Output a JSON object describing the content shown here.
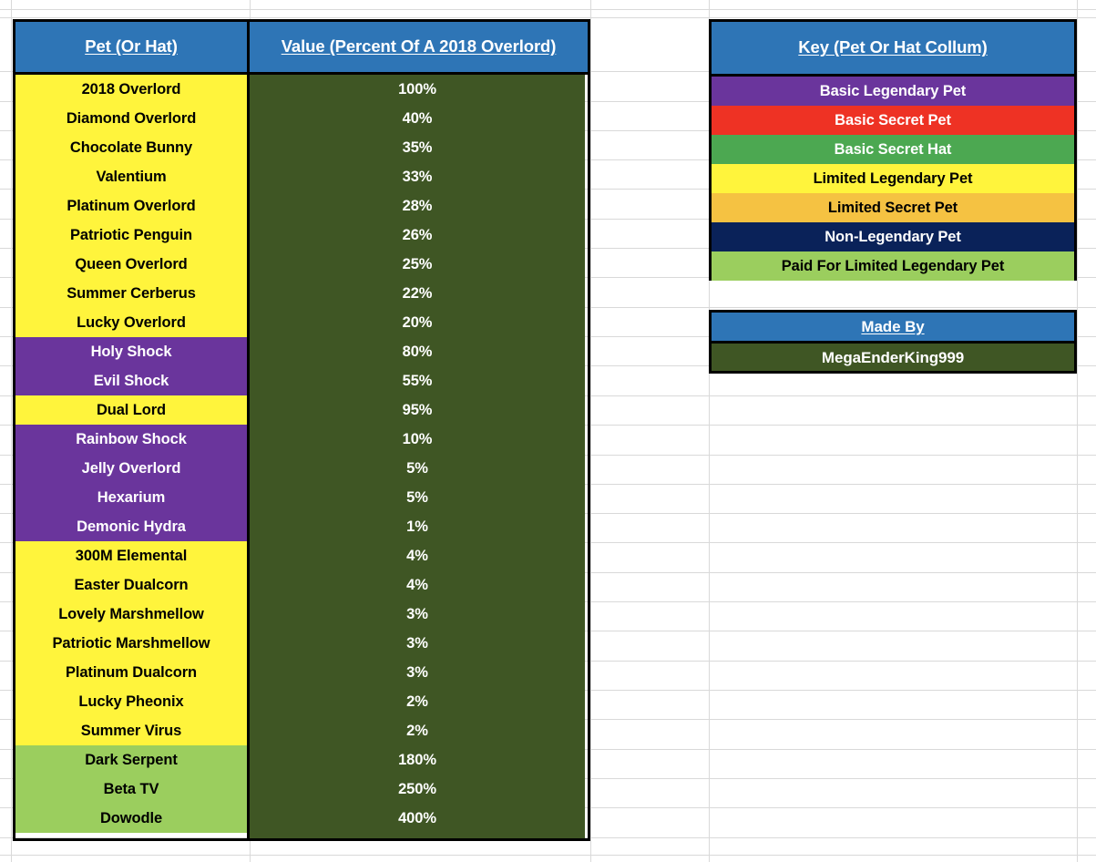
{
  "main_table": {
    "headers": {
      "pet": "Pet (Or Hat)",
      "value": "Value (Percent Of A 2018 Overlord)"
    },
    "rows": [
      {
        "pet": "2018 Overlord",
        "value": "100%",
        "color": "c-yellow"
      },
      {
        "pet": "Diamond Overlord",
        "value": "40%",
        "color": "c-yellow"
      },
      {
        "pet": "Chocolate Bunny",
        "value": "35%",
        "color": "c-yellow"
      },
      {
        "pet": "Valentium",
        "value": "33%",
        "color": "c-yellow"
      },
      {
        "pet": "Platinum Overlord",
        "value": "28%",
        "color": "c-yellow"
      },
      {
        "pet": "Patriotic Penguin",
        "value": "26%",
        "color": "c-yellow"
      },
      {
        "pet": "Queen Overlord",
        "value": "25%",
        "color": "c-yellow"
      },
      {
        "pet": "Summer Cerberus",
        "value": "22%",
        "color": "c-yellow"
      },
      {
        "pet": "Lucky Overlord",
        "value": "20%",
        "color": "c-yellow"
      },
      {
        "pet": "Holy Shock",
        "value": "80%",
        "color": "c-purple"
      },
      {
        "pet": "Evil Shock",
        "value": "55%",
        "color": "c-purple"
      },
      {
        "pet": "Dual Lord",
        "value": "95%",
        "color": "c-yellow"
      },
      {
        "pet": "Rainbow Shock",
        "value": "10%",
        "color": "c-purple"
      },
      {
        "pet": "Jelly Overlord",
        "value": "5%",
        "color": "c-purple"
      },
      {
        "pet": "Hexarium",
        "value": "5%",
        "color": "c-purple"
      },
      {
        "pet": "Demonic Hydra",
        "value": "1%",
        "color": "c-purple"
      },
      {
        "pet": "300M Elemental",
        "value": "4%",
        "color": "c-yellow"
      },
      {
        "pet": "Easter Dualcorn",
        "value": "4%",
        "color": "c-yellow"
      },
      {
        "pet": "Lovely Marshmellow",
        "value": "3%",
        "color": "c-yellow"
      },
      {
        "pet": "Patriotic Marshmellow",
        "value": "3%",
        "color": "c-yellow"
      },
      {
        "pet": "Platinum Dualcorn",
        "value": "3%",
        "color": "c-yellow"
      },
      {
        "pet": "Lucky Pheonix",
        "value": "2%",
        "color": "c-yellow"
      },
      {
        "pet": "Summer Virus",
        "value": "2%",
        "color": "c-yellow"
      },
      {
        "pet": "Dark Serpent",
        "value": "180%",
        "color": "c-lgreen"
      },
      {
        "pet": "Beta TV",
        "value": "250%",
        "color": "c-lgreen"
      },
      {
        "pet": "Dowodle",
        "value": "400%",
        "color": "c-lgreen"
      }
    ]
  },
  "key_table": {
    "header": "Key (Pet Or Hat Collum)",
    "entries": [
      {
        "label": "Basic Legendary Pet",
        "color": "c-purple"
      },
      {
        "label": "Basic Secret Pet",
        "color": "c-red"
      },
      {
        "label": "Basic Secret Hat",
        "color": "c-green"
      },
      {
        "label": "Limited Legendary Pet",
        "color": "c-yellow"
      },
      {
        "label": "Limited Secret Pet",
        "color": "c-orange"
      },
      {
        "label": "Non-Legendary Pet",
        "color": "c-navy"
      },
      {
        "label": "Paid For Limited Legendary Pet",
        "color": "c-lgreen"
      }
    ]
  },
  "made_by": {
    "header": "Made By",
    "author": "MegaEnderKing999"
  },
  "colors": {
    "header_blue": "#2E75B6",
    "value_olive": "#3F5624",
    "yellow": "#FFF43C",
    "purple": "#6A359C",
    "red": "#EE3224",
    "green": "#4CA851",
    "orange": "#F5C242",
    "navy": "#0A2259",
    "light_green": "#9BCE5E",
    "gridline": "#d9d9d9"
  },
  "grid": {
    "hlines": [
      10,
      19,
      78,
      111,
      143,
      175,
      207,
      240,
      272,
      304,
      337,
      369,
      401,
      434,
      466,
      499,
      531,
      563,
      595,
      628,
      660,
      692,
      725,
      757,
      789,
      822,
      854,
      886,
      919,
      938
    ],
    "vlines": [
      12,
      274,
      648,
      778,
      1182
    ]
  }
}
